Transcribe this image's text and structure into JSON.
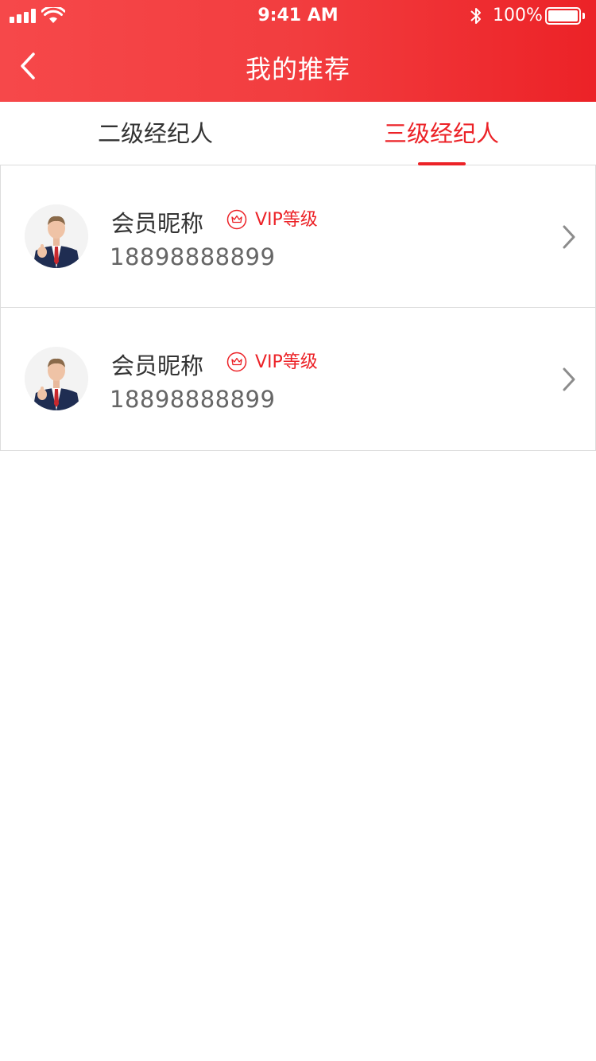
{
  "status_bar": {
    "time": "9:41 AM",
    "battery": "100%"
  },
  "nav": {
    "title": "我的推荐"
  },
  "tabs": [
    {
      "label": "二级经纪人",
      "active": false
    },
    {
      "label": "三级经纪人",
      "active": true
    }
  ],
  "members": [
    {
      "nickname": "会员昵称",
      "vip_label": "VIP等级",
      "phone": "18898888899"
    },
    {
      "nickname": "会员昵称",
      "vip_label": "VIP等级",
      "phone": "18898888899"
    }
  ],
  "colors": {
    "accent": "#ec2227",
    "header_start": "#f6484a",
    "header_end": "#ec2227"
  },
  "icons": [
    "back-icon",
    "crown-icon",
    "chevron-right-icon",
    "wifi-icon",
    "bluetooth-icon",
    "battery-icon",
    "signal-icon"
  ]
}
